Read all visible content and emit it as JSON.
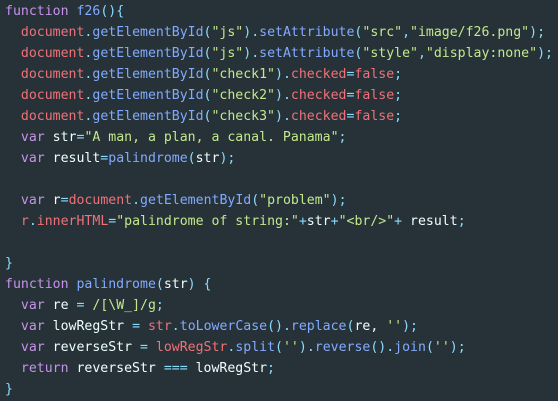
{
  "theme": {
    "background": "#263238",
    "keyword": "#c792ea",
    "function": "#82aaff",
    "object": "#f07178",
    "operator": "#89ddff",
    "string": "#c3e88d",
    "text": "#eeffff"
  },
  "code_lines": [
    [
      [
        "kw",
        "function"
      ],
      [
        "var",
        " "
      ],
      [
        "fn",
        "f26"
      ],
      [
        "punc",
        "(){"
      ]
    ],
    [
      [
        "var",
        "  "
      ],
      [
        "obj",
        "document"
      ],
      [
        "punc",
        "."
      ],
      [
        "fn",
        "getElementById"
      ],
      [
        "punc",
        "("
      ],
      [
        "str",
        "\"js\""
      ],
      [
        "punc",
        ")."
      ],
      [
        "fn",
        "setAttribute"
      ],
      [
        "punc",
        "("
      ],
      [
        "str",
        "\"src\""
      ],
      [
        "punc",
        ","
      ],
      [
        "str",
        "\"image/f26.png\""
      ],
      [
        "punc",
        ");"
      ]
    ],
    [
      [
        "var",
        "  "
      ],
      [
        "obj",
        "document"
      ],
      [
        "punc",
        "."
      ],
      [
        "fn",
        "getElementById"
      ],
      [
        "punc",
        "("
      ],
      [
        "str",
        "\"js\""
      ],
      [
        "punc",
        ")."
      ],
      [
        "fn",
        "setAttribute"
      ],
      [
        "punc",
        "("
      ],
      [
        "str",
        "\"style\""
      ],
      [
        "punc",
        ","
      ],
      [
        "str",
        "\"display:none\""
      ],
      [
        "punc",
        ");"
      ]
    ],
    [
      [
        "var",
        "  "
      ],
      [
        "obj",
        "document"
      ],
      [
        "punc",
        "."
      ],
      [
        "fn",
        "getElementById"
      ],
      [
        "punc",
        "("
      ],
      [
        "str",
        "\"check1\""
      ],
      [
        "punc",
        ")."
      ],
      [
        "prop",
        "checked"
      ],
      [
        "op",
        "="
      ],
      [
        "obj",
        "false"
      ],
      [
        "punc",
        ";"
      ]
    ],
    [
      [
        "var",
        "  "
      ],
      [
        "obj",
        "document"
      ],
      [
        "punc",
        "."
      ],
      [
        "fn",
        "getElementById"
      ],
      [
        "punc",
        "("
      ],
      [
        "str",
        "\"check2\""
      ],
      [
        "punc",
        ")."
      ],
      [
        "prop",
        "checked"
      ],
      [
        "op",
        "="
      ],
      [
        "obj",
        "false"
      ],
      [
        "punc",
        ";"
      ]
    ],
    [
      [
        "var",
        "  "
      ],
      [
        "obj",
        "document"
      ],
      [
        "punc",
        "."
      ],
      [
        "fn",
        "getElementById"
      ],
      [
        "punc",
        "("
      ],
      [
        "str",
        "\"check3\""
      ],
      [
        "punc",
        ")."
      ],
      [
        "prop",
        "checked"
      ],
      [
        "op",
        "="
      ],
      [
        "obj",
        "false"
      ],
      [
        "punc",
        ";"
      ]
    ],
    [
      [
        "var",
        "  "
      ],
      [
        "kw",
        "var"
      ],
      [
        "var",
        " str"
      ],
      [
        "op",
        "="
      ],
      [
        "str",
        "\"A man, a plan, a canal. Panama\""
      ],
      [
        "punc",
        ";"
      ]
    ],
    [
      [
        "var",
        "  "
      ],
      [
        "kw",
        "var"
      ],
      [
        "var",
        " result"
      ],
      [
        "op",
        "="
      ],
      [
        "fn",
        "palindrome"
      ],
      [
        "punc",
        "("
      ],
      [
        "var",
        "str"
      ],
      [
        "punc",
        ");"
      ]
    ],
    [
      [
        "var",
        ""
      ]
    ],
    [
      [
        "var",
        "  "
      ],
      [
        "kw",
        "var"
      ],
      [
        "var",
        " r"
      ],
      [
        "op",
        "="
      ],
      [
        "obj",
        "document"
      ],
      [
        "punc",
        "."
      ],
      [
        "fn",
        "getElementById"
      ],
      [
        "punc",
        "("
      ],
      [
        "str",
        "\"problem\""
      ],
      [
        "punc",
        ");"
      ]
    ],
    [
      [
        "var",
        "  "
      ],
      [
        "obj",
        "r"
      ],
      [
        "punc",
        "."
      ],
      [
        "prop",
        "innerHTML"
      ],
      [
        "op",
        "="
      ],
      [
        "str",
        "\"palindrome of string:\""
      ],
      [
        "op",
        "+"
      ],
      [
        "var",
        "str"
      ],
      [
        "op",
        "+"
      ],
      [
        "str",
        "\"<br/>\""
      ],
      [
        "op",
        "+"
      ],
      [
        "var",
        " result"
      ],
      [
        "punc",
        ";"
      ]
    ],
    [
      [
        "var",
        ""
      ]
    ],
    [
      [
        "punc",
        "}"
      ]
    ],
    [
      [
        "kw",
        "function"
      ],
      [
        "var",
        " "
      ],
      [
        "fn",
        "palindrome"
      ],
      [
        "punc",
        "("
      ],
      [
        "var",
        "str"
      ],
      [
        "punc",
        ") {"
      ]
    ],
    [
      [
        "var",
        "  "
      ],
      [
        "kw",
        "var"
      ],
      [
        "var",
        " re "
      ],
      [
        "op",
        "="
      ],
      [
        "var",
        " "
      ],
      [
        "str",
        "/[\\W_]/g"
      ],
      [
        "punc",
        ";"
      ]
    ],
    [
      [
        "var",
        "  "
      ],
      [
        "kw",
        "var"
      ],
      [
        "var",
        " lowRegStr "
      ],
      [
        "op",
        "="
      ],
      [
        "var",
        " "
      ],
      [
        "obj",
        "str"
      ],
      [
        "punc",
        "."
      ],
      [
        "fn",
        "toLowerCase"
      ],
      [
        "punc",
        "()."
      ],
      [
        "fn",
        "replace"
      ],
      [
        "punc",
        "("
      ],
      [
        "var",
        "re, "
      ],
      [
        "str",
        "''"
      ],
      [
        "punc",
        ");"
      ]
    ],
    [
      [
        "var",
        "  "
      ],
      [
        "kw",
        "var"
      ],
      [
        "var",
        " reverseStr "
      ],
      [
        "op",
        "="
      ],
      [
        "var",
        " "
      ],
      [
        "obj",
        "lowRegStr"
      ],
      [
        "punc",
        "."
      ],
      [
        "fn",
        "split"
      ],
      [
        "punc",
        "("
      ],
      [
        "str",
        "''"
      ],
      [
        "punc",
        ")."
      ],
      [
        "fn",
        "reverse"
      ],
      [
        "punc",
        "()."
      ],
      [
        "fn",
        "join"
      ],
      [
        "punc",
        "("
      ],
      [
        "str",
        "''"
      ],
      [
        "punc",
        ");"
      ]
    ],
    [
      [
        "var",
        "  "
      ],
      [
        "kw",
        "return"
      ],
      [
        "var",
        " reverseStr "
      ],
      [
        "op",
        "==="
      ],
      [
        "var",
        " lowRegStr"
      ],
      [
        "punc",
        ";"
      ]
    ],
    [
      [
        "punc",
        "}"
      ]
    ]
  ]
}
